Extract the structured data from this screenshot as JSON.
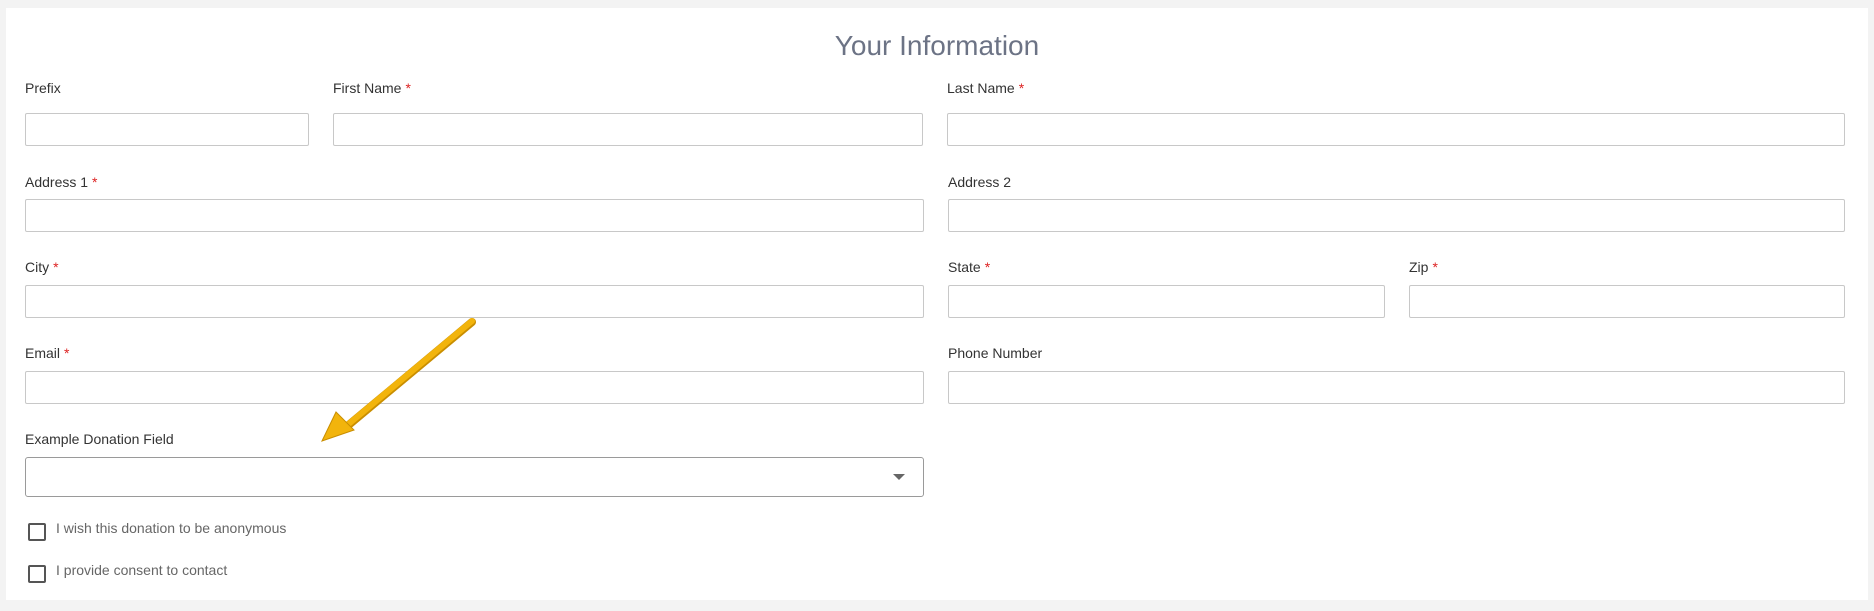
{
  "form": {
    "title": "Your Information",
    "required_marker": "*",
    "fields": {
      "prefix": {
        "label": "Prefix",
        "value": ""
      },
      "first_name": {
        "label": "First Name",
        "value": ""
      },
      "last_name": {
        "label": "Last Name",
        "value": ""
      },
      "address1": {
        "label": "Address 1",
        "value": ""
      },
      "address2": {
        "label": "Address 2",
        "value": ""
      },
      "city": {
        "label": "City",
        "value": ""
      },
      "state": {
        "label": "State",
        "value": ""
      },
      "zip": {
        "label": "Zip",
        "value": ""
      },
      "email": {
        "label": "Email",
        "value": ""
      },
      "phone": {
        "label": "Phone Number",
        "value": ""
      },
      "donation": {
        "label": "Example Donation Field",
        "value": ""
      }
    },
    "checkboxes": {
      "anonymous": {
        "label": "I wish this donation to be anonymous",
        "checked": false
      },
      "consent": {
        "label": "I provide consent to contact",
        "checked": false
      }
    }
  },
  "annotation": {
    "color": "#f0b20a",
    "icon": "arrow-annotation-icon"
  }
}
